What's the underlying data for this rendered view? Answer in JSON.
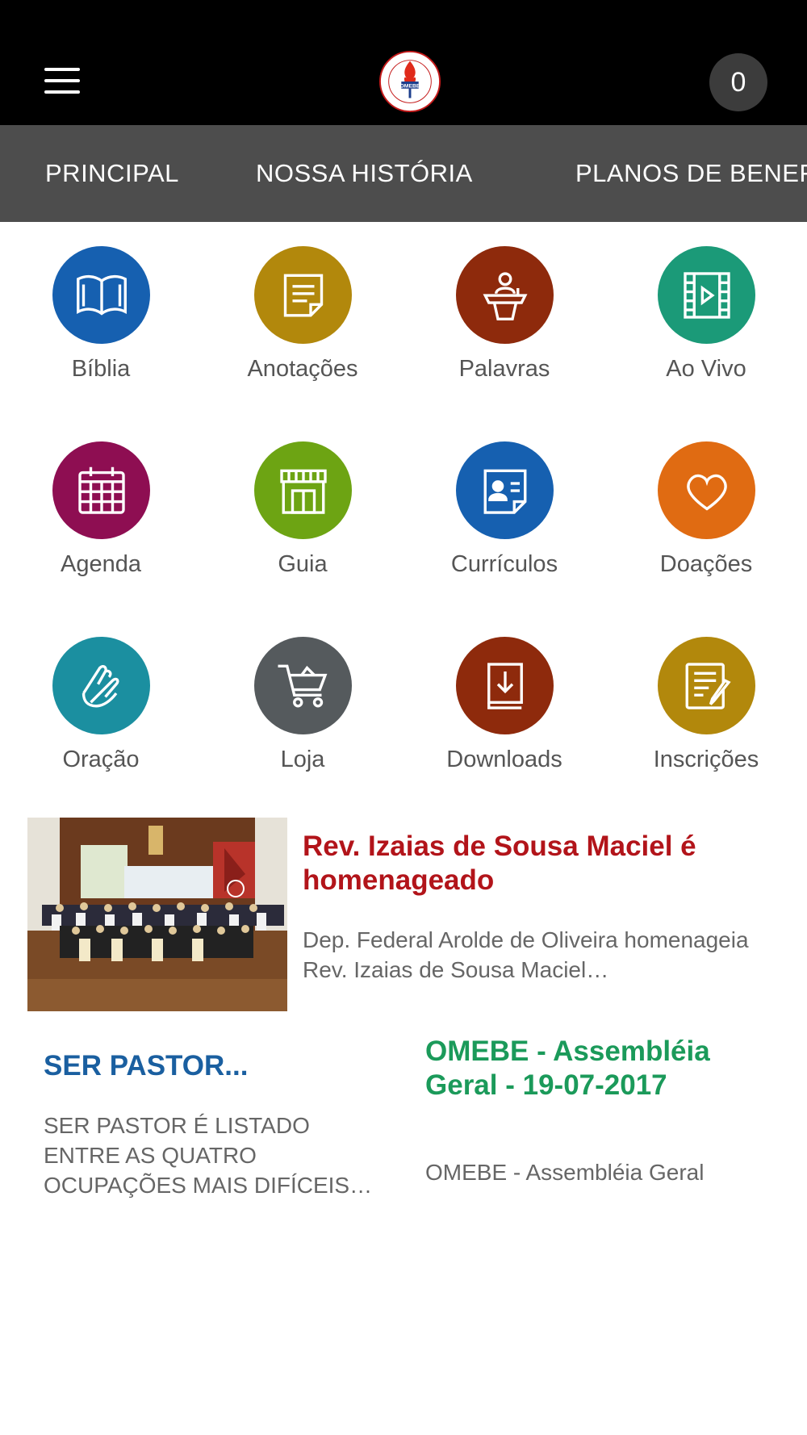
{
  "header": {
    "menu_icon": "hamburger-menu-icon",
    "logo": {
      "text": "OMEBE",
      "ring_text": "ORDEM DOS MINISTROS EVANGÉLICOS NO BRASIL E NO EXTERIOR"
    },
    "cart_count": "0"
  },
  "tabs": [
    {
      "label": "PRINCIPAL"
    },
    {
      "label": "NOSSA HISTÓRIA"
    },
    {
      "label": "PLANOS DE BENEFÍ"
    }
  ],
  "grid": [
    {
      "label": "Bíblia",
      "icon": "bible-icon",
      "color": "#1660b0"
    },
    {
      "label": "Anotações",
      "icon": "notes-icon",
      "color": "#b2880c"
    },
    {
      "label": "Palavras",
      "icon": "pulpit-icon",
      "color": "#8e2a0c"
    },
    {
      "label": "Ao Vivo",
      "icon": "live-video-icon",
      "color": "#1b9a78"
    },
    {
      "label": "Agenda",
      "icon": "calendar-icon",
      "color": "#8e0e52"
    },
    {
      "label": "Guia",
      "icon": "storefront-icon",
      "color": "#6da413"
    },
    {
      "label": "Currículos",
      "icon": "resume-icon",
      "color": "#1660b0"
    },
    {
      "label": "Doações",
      "icon": "heart-icon",
      "color": "#e06b12"
    },
    {
      "label": "Oração",
      "icon": "praying-hands-icon",
      "color": "#1b8fa0"
    },
    {
      "label": "Loja",
      "icon": "shopping-cart-icon",
      "color": "#555a5d"
    },
    {
      "label": "Downloads",
      "icon": "download-book-icon",
      "color": "#8e2a0c"
    },
    {
      "label": "Inscrições",
      "icon": "registration-form-icon",
      "color": "#b2880c"
    }
  ],
  "news": [
    {
      "title": "Rev. Izaias de Sousa Maciel é homenageado",
      "description": "Dep. Federal Arolde de Oliveira homenageia Rev. Izaias de Sousa Maciel…",
      "color": "#b2141a"
    },
    {
      "title": "SER PASTOR...",
      "description": "SER PASTOR É LISTADO ENTRE AS QUATRO OCUPAÇÕES MAIS DIFÍCEIS…",
      "color": "#1a5fa0"
    },
    {
      "title": "OMEBE - Assembléia Geral - 19-07-2017",
      "description": "OMEBE - Assembléia Geral",
      "color": "#1b9a5a"
    }
  ]
}
